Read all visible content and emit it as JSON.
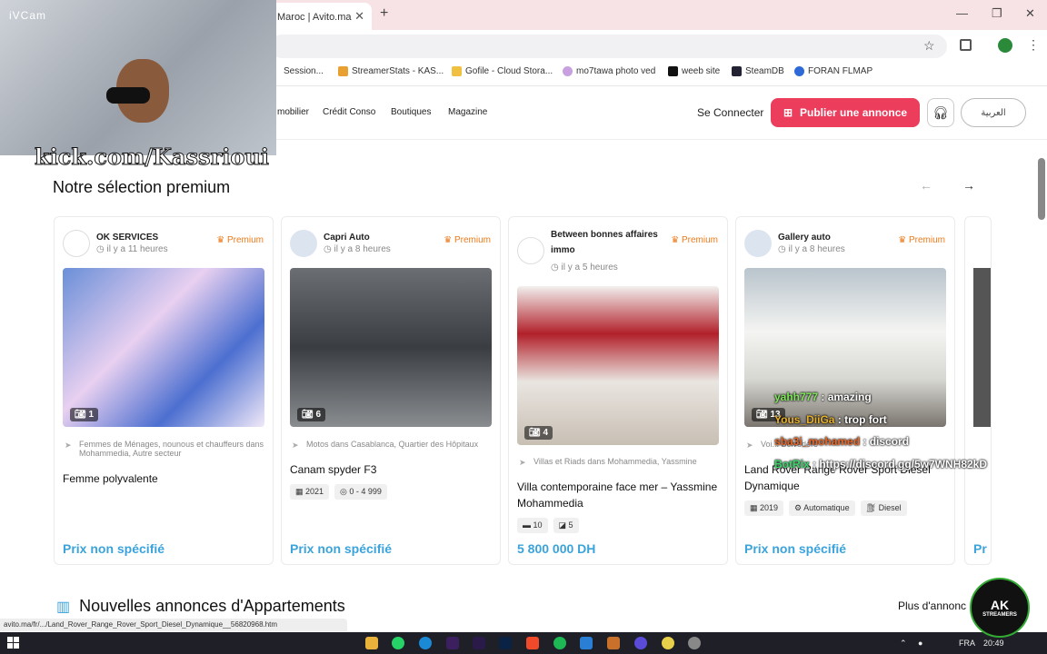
{
  "browser": {
    "tab_title": "Maroc | Avito.ma",
    "bookmarks": [
      "Session...",
      "StreamerStats - KAS...",
      "Gofile - Cloud Stora...",
      "mo7tawa photo ved",
      "weeb site",
      "SteamDB",
      "FORAN FLMAP"
    ],
    "status_url": "avito.ma/fr/.../Land_Rover_Range_Rover_Sport_Diesel_Dynamique__56820968.htm"
  },
  "site": {
    "nav": [
      "mobilier",
      "Crédit Conso",
      "Boutiques",
      "Magazine"
    ],
    "connect": "Se Connecter",
    "publish": "Publier une annonce",
    "lang": "العربية"
  },
  "section": {
    "title": "Notre sélection premium",
    "cards": [
      {
        "seller": "OK SERVICES",
        "time": "il y a 11 heures",
        "badge": "Premium",
        "count": "1",
        "category": "Femmes de Ménages, nounous et chauffeurs dans Mohammedia, Autre secteur",
        "title": "Femme polyvalente",
        "tags": [],
        "price": "Prix non spécifié"
      },
      {
        "seller": "Capri Auto",
        "time": "il y a 8 heures",
        "badge": "Premium",
        "count": "6",
        "category": "Motos dans Casablanca, Quartier des Hôpitaux",
        "title": "Canam spyder F3",
        "tags": [
          "2021",
          "0 - 4 999"
        ],
        "price": "Prix non spécifié"
      },
      {
        "seller": "Between bonnes affaires immo",
        "time": "il y a 5 heures",
        "badge": "Premium",
        "count": "4",
        "category": "Villas et Riads dans Mohammedia, Yassmine",
        "title": "Villa contemporaine face mer – Yassmine Mohammedia",
        "tags": [
          "10",
          "5"
        ],
        "price": "5 800 000 DH"
      },
      {
        "seller": "Gallery auto",
        "time": "il y a 8 heures",
        "badge": "Premium",
        "count": "13",
        "category": "Voi... Belvédère",
        "title": "Land Rover Range Rover Sport Diesel Dynamique",
        "tags": [
          "2019",
          "Automatique",
          "Diesel"
        ],
        "price": "Prix non spécifié"
      }
    ],
    "peek_price": "Pr"
  },
  "section2": {
    "title": "Nouvelles annonces d'Appartements",
    "more": "Plus d'annonc"
  },
  "overlay": {
    "cam_label": "iVCam",
    "kick": "kick.com/Kassrioui",
    "chat": [
      {
        "user": "yahh777",
        "msg": " : amazing"
      },
      {
        "user": "Yous_DiiGa",
        "msg": " : trop fort"
      },
      {
        "user": "sba3i_mohamed",
        "msg": " : discord"
      },
      {
        "user": "BotRix",
        "msg": " : https://discord.gg/5w7WNH82kD"
      }
    ],
    "logo": "AK",
    "logo_sub": "STREAMERS"
  },
  "taskbar": {
    "lang": "FRA",
    "time": "20:49"
  }
}
